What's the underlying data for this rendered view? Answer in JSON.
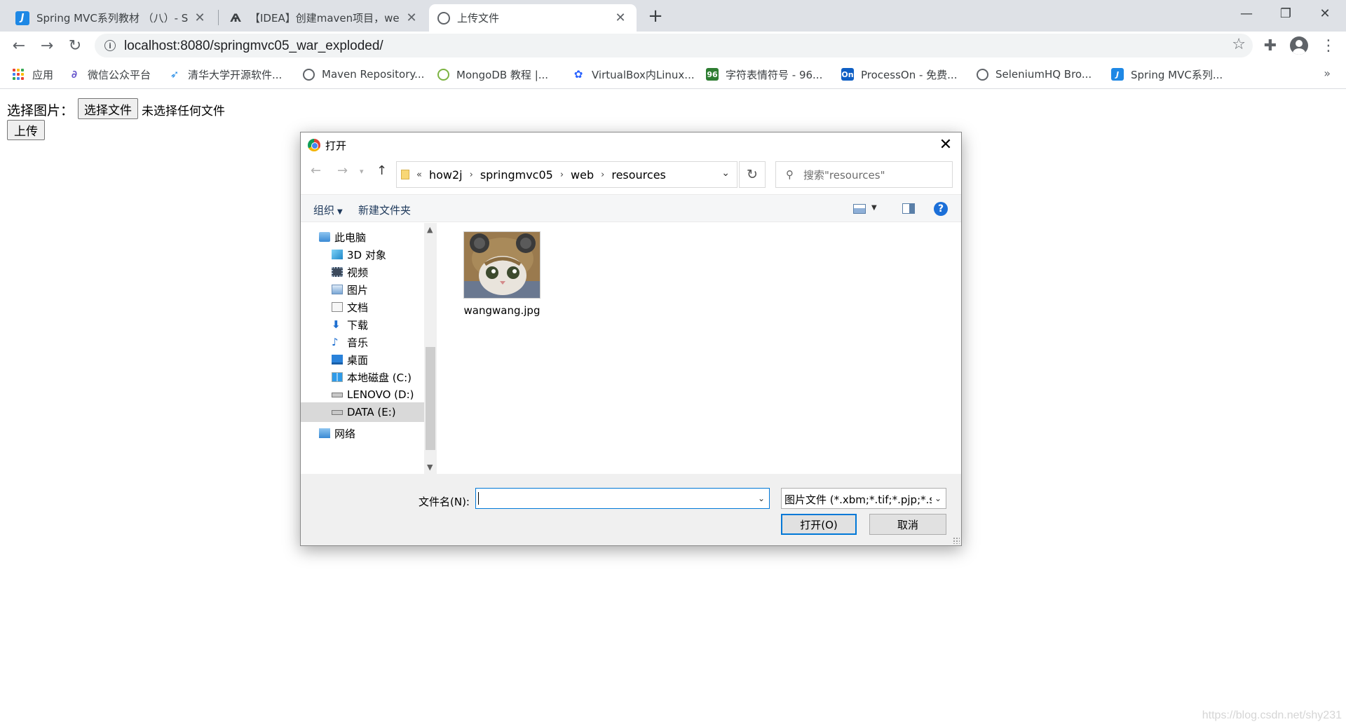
{
  "tabs": [
    {
      "title": "Spring MVC系列教材 （八）- Sp",
      "icon": "csdn-j-icon"
    },
    {
      "title": "【IDEA】创建maven项目，web",
      "icon": "idea-icon"
    },
    {
      "title": "上传文件",
      "icon": "globe-icon",
      "active": true
    }
  ],
  "address_bar": {
    "url": "localhost:8080/springmvc05_war_exploded/"
  },
  "bookmarks": [
    {
      "label": "应用",
      "icon": "apps-grid-icon"
    },
    {
      "label": "微信公众平台",
      "icon": "wechat-icon"
    },
    {
      "label": "清华大学开源软件...",
      "icon": "tsinghua-icon"
    },
    {
      "label": "Maven Repository...",
      "icon": "globe-icon"
    },
    {
      "label": "MongoDB 教程 |...",
      "icon": "runoob-icon"
    },
    {
      "label": "VirtualBox内Linux...",
      "icon": "baidu-paw-icon"
    },
    {
      "label": "字符表情符号 - 96...",
      "icon": "96-icon",
      "icon_text": "96"
    },
    {
      "label": "ProcessOn - 免费...",
      "icon": "processon-icon",
      "icon_text": "On"
    },
    {
      "label": "SeleniumHQ Bro...",
      "icon": "globe-icon"
    },
    {
      "label": "Spring MVC系列...",
      "icon": "csdn-j-icon"
    }
  ],
  "page": {
    "choose_label": "选择图片：",
    "choose_button": "选择文件",
    "no_file_text": "未选择任何文件",
    "upload_button": "上传",
    "watermark": "https://blog.csdn.net/shy231"
  },
  "dialog": {
    "title": "打开",
    "breadcrumb": [
      "how2j",
      "springmvc05",
      "web",
      "resources"
    ],
    "breadcrumb_prefix": "«",
    "search_placeholder": "搜索\"resources\"",
    "commands": {
      "organize": "组织",
      "new_folder": "新建文件夹"
    },
    "tree": [
      {
        "label": "此电脑",
        "icon": "computer-icon"
      },
      {
        "label": "3D 对象",
        "icon": "3d-objects-icon"
      },
      {
        "label": "视频",
        "icon": "video-icon"
      },
      {
        "label": "图片",
        "icon": "pictures-icon"
      },
      {
        "label": "文档",
        "icon": "documents-icon"
      },
      {
        "label": "下载",
        "icon": "download-icon"
      },
      {
        "label": "音乐",
        "icon": "music-icon"
      },
      {
        "label": "桌面",
        "icon": "desktop-icon"
      },
      {
        "label": "本地磁盘 (C:)",
        "icon": "windows-drive-icon"
      },
      {
        "label": "LENOVO (D:)",
        "icon": "drive-icon"
      },
      {
        "label": "DATA (E:)",
        "icon": "drive-icon",
        "selected": true
      },
      {
        "label": "网络",
        "icon": "network-icon"
      }
    ],
    "files": [
      {
        "name": "wangwang.jpg",
        "icon": "cat-photo-thumbnail"
      }
    ],
    "filename_label": "文件名(N):",
    "filename_value": "",
    "filter": "图片文件 (*.xbm;*.tif;*.pjp;*.svg",
    "open_button": "打开(O)",
    "cancel_button": "取消"
  }
}
